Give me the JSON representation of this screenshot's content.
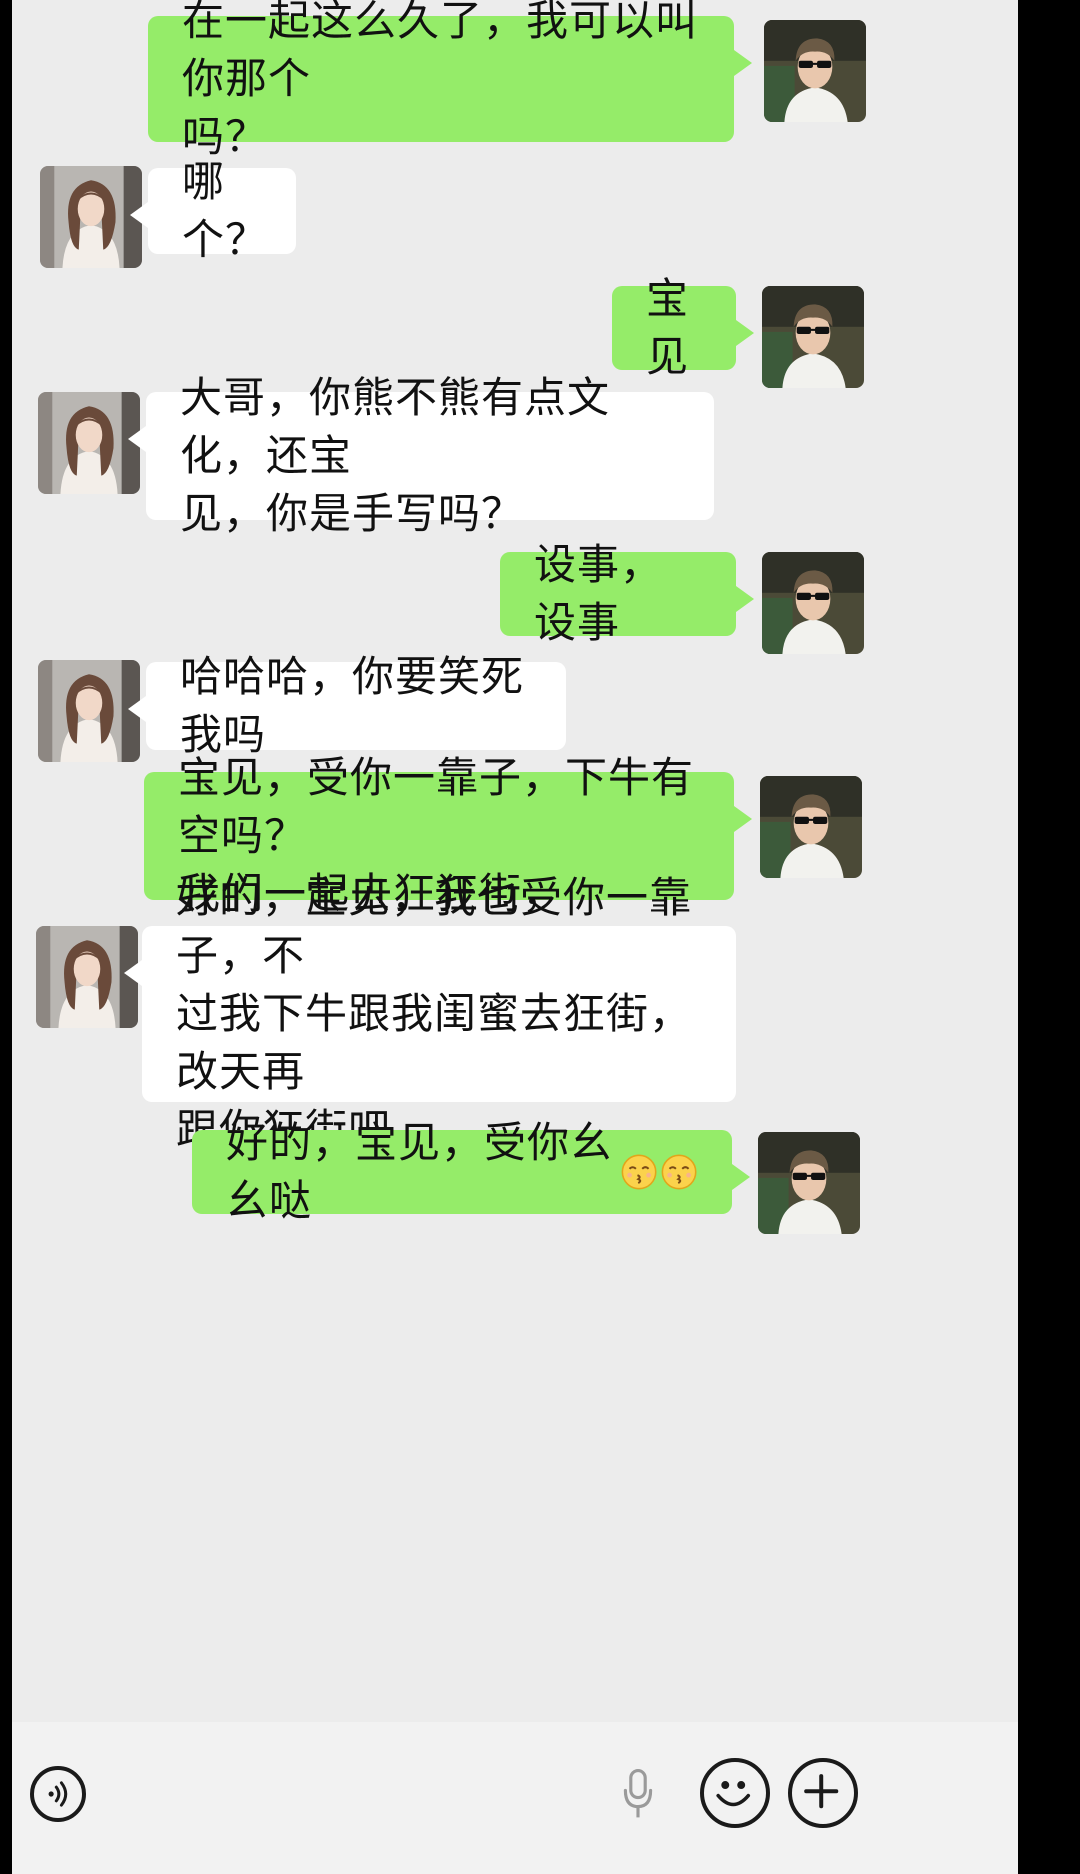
{
  "messages": [
    {
      "side": "sent",
      "text": "在一起这么久了，我可以叫你那个\n吗？"
    },
    {
      "side": "recv",
      "text": "哪个？"
    },
    {
      "side": "sent",
      "text": "宝见"
    },
    {
      "side": "recv",
      "text": "大哥，你熊不熊有点文化，还宝\n见，你是手写吗？"
    },
    {
      "side": "sent",
      "text": "设事，设事"
    },
    {
      "side": "recv",
      "text": "哈哈哈，你要笑死我吗"
    },
    {
      "side": "sent",
      "text": "宝见，受你一靠子，下牛有空吗？\n我们一起去狂狂街，"
    },
    {
      "side": "recv",
      "text": "好的，宝见，我也受你一靠子，不\n过我下牛跟我闺蜜去狂街，改天再\n跟你狂街吧"
    },
    {
      "side": "sent",
      "text": "好的，宝见，受你幺幺哒",
      "emojis": [
        "kissing-face",
        "kissing-face"
      ]
    }
  ],
  "avatars": {
    "self": "man-with-sunglasses-avatar",
    "contact": "woman-portrait-avatar"
  },
  "bottom_bar": {
    "voice_icon": "voice-input-icon",
    "mic_icon": "microphone-icon",
    "emoji_icon": "emoji-icon",
    "plus_icon": "plus-icon"
  },
  "colors": {
    "background": "#ececec",
    "sent_bubble": "#95ec69",
    "received_bubble": "#ffffff"
  }
}
